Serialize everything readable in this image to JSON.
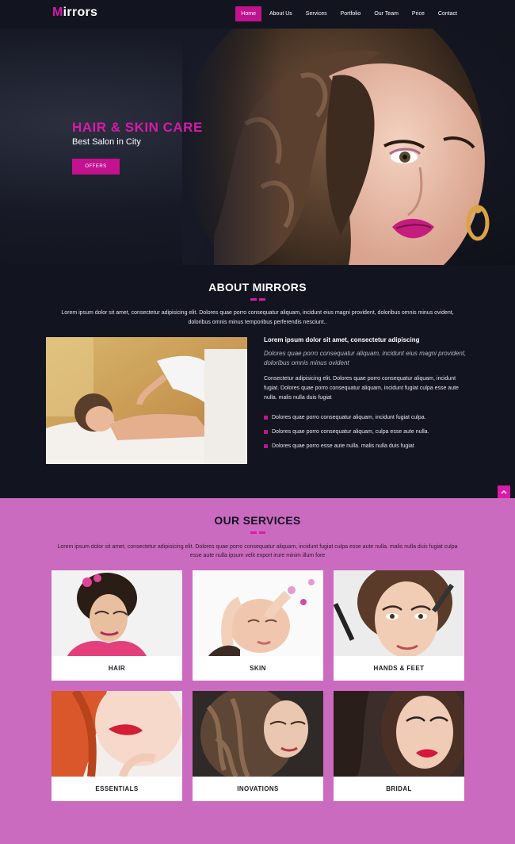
{
  "nav": {
    "logo": "Mirrors",
    "logo_first": "M",
    "logo_rest": "irrors",
    "items": [
      {
        "label": "Home",
        "active": true
      },
      {
        "label": "About Us"
      },
      {
        "label": "Services"
      },
      {
        "label": "Portfolio"
      },
      {
        "label": "Our Team"
      },
      {
        "label": "Price"
      },
      {
        "label": "Contact"
      }
    ]
  },
  "hero": {
    "title": "HAIR & SKIN CARE",
    "subtitle": "Best Salon in City",
    "button": "OFFERS"
  },
  "about": {
    "title": "ABOUT MIRRORS",
    "lead": "Lorem ipsum dolor sit amet, consectetur adipisicing elit. Dolores quae porro consequatur aliquam, incidunt eius magni provident, doloribus omnis minus ovident, doloribus omnis minus temporibus perferendis nesciunt..",
    "heading": "Lorem ipsum dolor sit amet, consectetur adipiscing",
    "italic": "Dolores quae porro consequatur aliquam, incidunt eius magni provident, doloribus omnis minus ovident",
    "paragraph": "Consectetur adipisicing elit. Dolores quae porro consequatur aliquam, incidunt fugiat. Dolores quae porro consequatur aliquam, incidunt fugiat culpa esse aute nulla. malis nulla duis fugiat",
    "bullets": [
      "Dolores quae porro consequatur aliquam, incidunt fugiat culpa.",
      "Dolores quae porro consequatur aliquam, culpa esse aute nulla.",
      "Dolores quae porro esse aute nulla. malis nulla duis fugiat"
    ]
  },
  "services": {
    "title": "OUR SERVICES",
    "lead": "Lorem ipsum dolor sit amet, consectetur adipisicing elit. Dolores quae porro consequatur aliquam, incidunt fugiat culpa esse aute nulla. malis nulla duis fugiat culpa esse aute nulla ipsum velit export irure minim illum fore",
    "cards": [
      {
        "label": "HAIR"
      },
      {
        "label": "SKIN"
      },
      {
        "label": "HANDS & FEET"
      },
      {
        "label": "ESSENTIALS"
      },
      {
        "label": "INOVATIONS"
      },
      {
        "label": "BRIDAL"
      }
    ]
  },
  "colors": {
    "accent": "#d81aa9",
    "button": "#c2128f",
    "dark_bg": "#12141f",
    "services_bg": "#cb6bc0"
  },
  "icons": {
    "scroll_top": "chevron-up-icon",
    "bullet": "square-bullet-icon"
  }
}
